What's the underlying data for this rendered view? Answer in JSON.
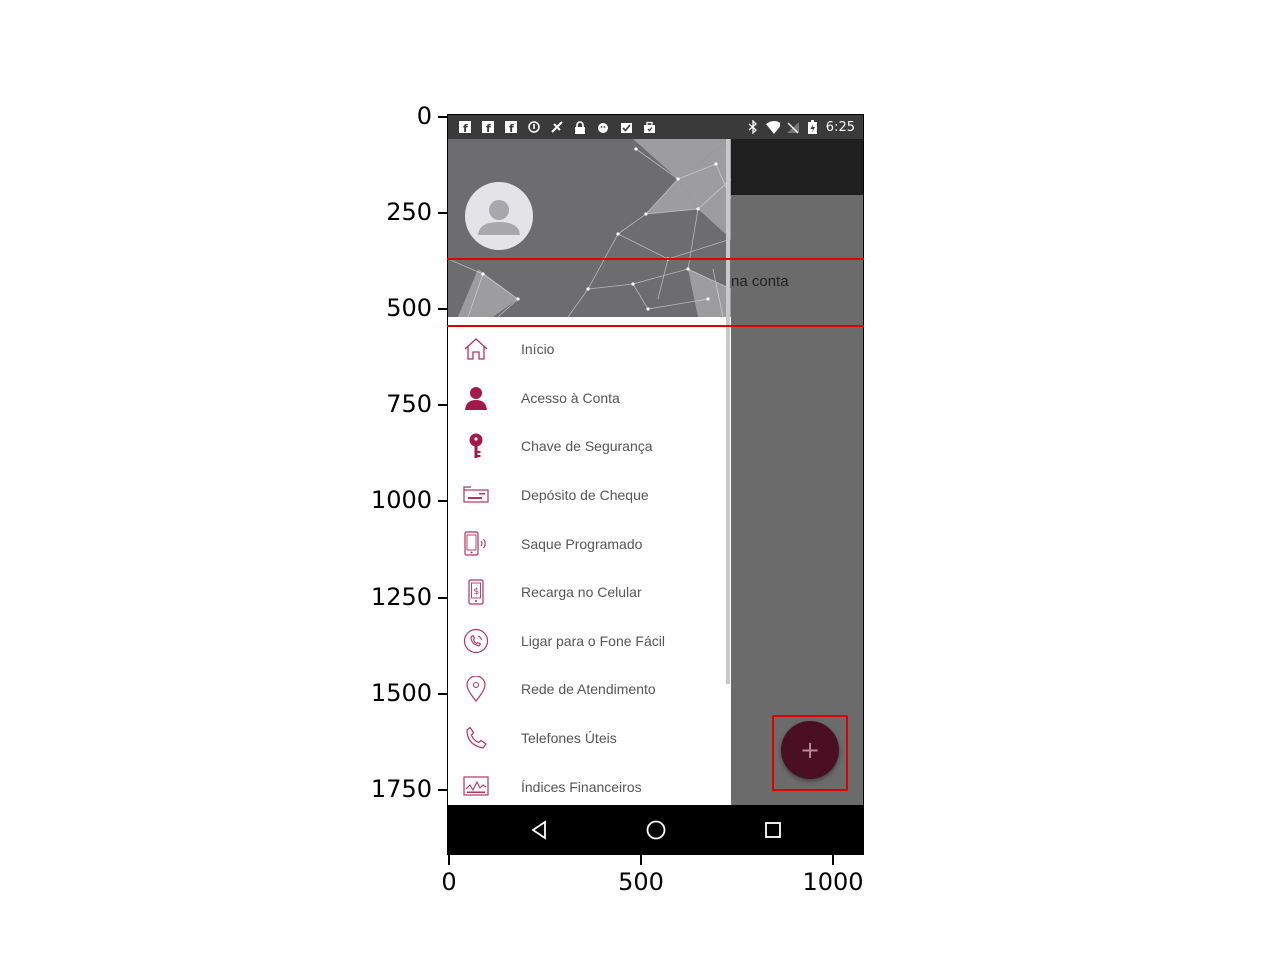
{
  "axes": {
    "y_ticks": [
      "0",
      "250",
      "500",
      "750",
      "1000",
      "1250",
      "1500",
      "1750"
    ],
    "x_ticks": [
      "0",
      "500",
      "1000"
    ]
  },
  "status_bar": {
    "time": "6:25",
    "left_icons": [
      "facebook-icon",
      "facebook-icon",
      "facebook-icon",
      "info-icon",
      "satellite-icon",
      "lock-icon",
      "android-icon",
      "clipboard-check-icon",
      "bag-icon"
    ],
    "right_icons": [
      "bluetooth-icon",
      "wifi-icon",
      "no-signal-icon",
      "battery-charging-icon"
    ]
  },
  "background_screen": {
    "partial_text": "na conta"
  },
  "drawer": {
    "menu": [
      {
        "label": "Início",
        "icon": "home-icon"
      },
      {
        "label": "Acesso à Conta",
        "icon": "user-icon"
      },
      {
        "label": "Chave de Segurança",
        "icon": "key-icon"
      },
      {
        "label": "Depósito de Cheque",
        "icon": "cheque-icon"
      },
      {
        "label": "Saque Programado",
        "icon": "phone-signal-icon"
      },
      {
        "label": "Recarga no Celular",
        "icon": "mobile-money-icon"
      },
      {
        "label": "Ligar para o Fone Fácil",
        "icon": "phone-circle-icon"
      },
      {
        "label": "Rede de Atendimento",
        "icon": "map-pin-icon"
      },
      {
        "label": "Telefones Úteis",
        "icon": "phone-icon"
      },
      {
        "label": "Índices Financeiros",
        "icon": "chart-icon"
      }
    ]
  },
  "fab": {
    "label": "+"
  },
  "colors": {
    "accent": "#a3194a",
    "icon_outline": "#b5345f",
    "fab": "#4a0f22",
    "highlight": "#e00000"
  }
}
